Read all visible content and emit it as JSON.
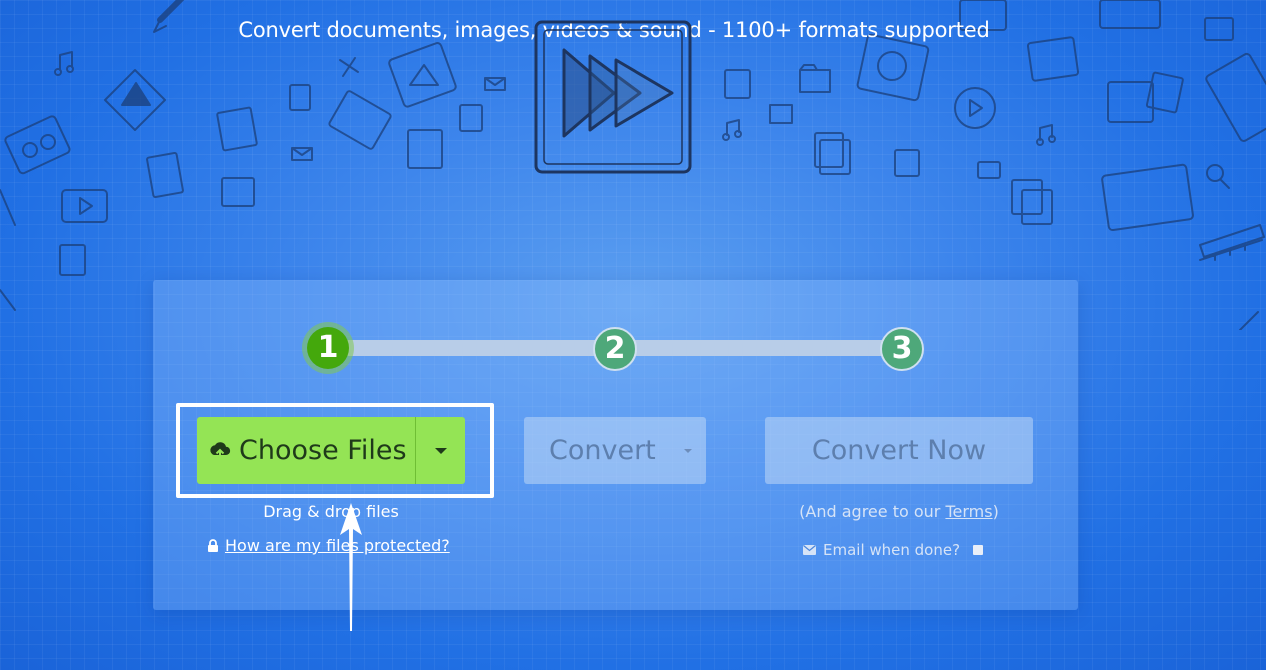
{
  "header": {
    "tagline": "Convert documents, images, videos & sound - 1100+ formats supported"
  },
  "steps": [
    "1",
    "2",
    "3"
  ],
  "actions": {
    "choose_files_label": "Choose Files",
    "convert_label": "Convert",
    "convert_now_label": "Convert Now"
  },
  "hints": {
    "drag_drop": "Drag & drop files",
    "protected_link": "How are my files protected?",
    "agree_prefix": "(And agree to our ",
    "terms_link": "Terms",
    "agree_suffix": ")",
    "email_label": "Email when done?"
  },
  "icons": {
    "upload": "cloud-upload-icon",
    "lock": "lock-icon",
    "mail": "envelope-icon",
    "logo": "fast-forward-logo"
  },
  "colors": {
    "background": "#2170e4",
    "choose_button": "#94e455",
    "step_active": "#44a80c",
    "step_inactive": "#4ea87a"
  }
}
